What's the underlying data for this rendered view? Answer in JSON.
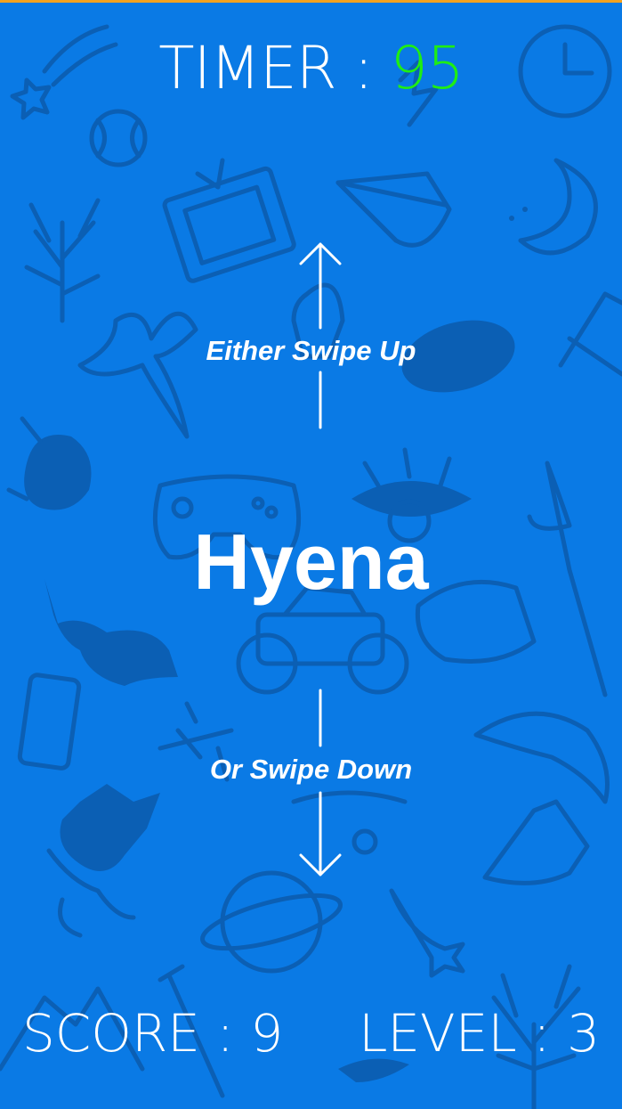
{
  "timer": {
    "label": "TIMER :",
    "value": "95"
  },
  "prompt": {
    "up": "Either Swipe Up",
    "down": "Or Swipe Down"
  },
  "word": "Hyena",
  "footer": {
    "score_label": "SCORE :",
    "score_value": "9",
    "level_label": "LEVEL :",
    "level_value": "3"
  },
  "colors": {
    "background": "#0a7ae5",
    "timer_value": "#1fee13",
    "accent_strip": "#f3a21f"
  },
  "icons": [
    "swipe-up-arrow-icon",
    "swipe-down-arrow-icon"
  ]
}
